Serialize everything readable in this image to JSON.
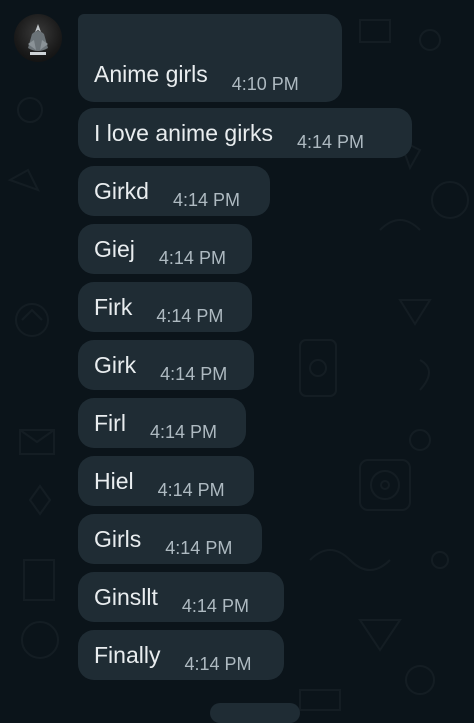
{
  "chat": {
    "contact_name_redacted": "",
    "messages": [
      {
        "text": "Anime girls",
        "time": "4:10 PM"
      },
      {
        "text": "I love anime girks",
        "time": "4:14 PM"
      },
      {
        "text": "Girkd",
        "time": "4:14 PM"
      },
      {
        "text": "Giej",
        "time": "4:14 PM"
      },
      {
        "text": "Firk",
        "time": "4:14 PM"
      },
      {
        "text": "Girk",
        "time": "4:14 PM"
      },
      {
        "text": "Firl",
        "time": "4:14 PM"
      },
      {
        "text": "Hiel",
        "time": "4:14 PM"
      },
      {
        "text": "Girls",
        "time": "4:14 PM"
      },
      {
        "text": "Ginsllt",
        "time": "4:14 PM"
      },
      {
        "text": "Finally",
        "time": "4:14 PM"
      }
    ]
  },
  "colors": {
    "background": "#0b141a",
    "bubble": "#1f2c34",
    "text": "#e9edef",
    "time": "#aebac1",
    "redaction": "#e23b3b"
  }
}
